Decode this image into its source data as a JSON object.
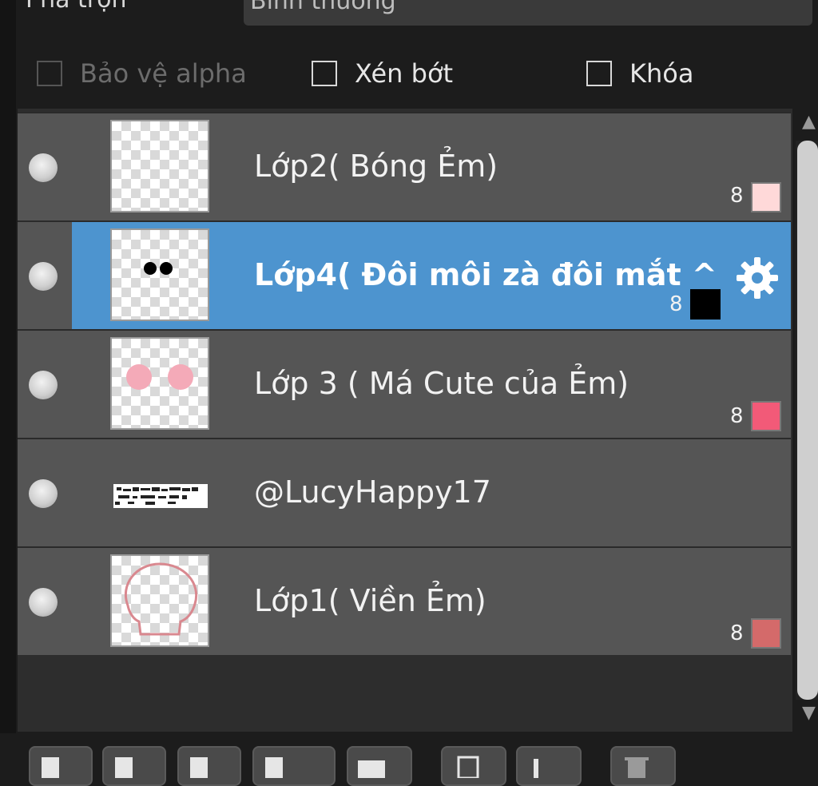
{
  "blend": {
    "label": "Pha trộn",
    "value": "Bình thường"
  },
  "options": [
    {
      "label": "Bảo vệ alpha",
      "checked": false,
      "enabled": false
    },
    {
      "label": "Xén bớt",
      "checked": false,
      "enabled": true
    },
    {
      "label": "Khóa",
      "checked": false,
      "enabled": true
    }
  ],
  "layers": [
    {
      "name": "Lớp2( Bóng Ẻm)",
      "badge": "8",
      "color": "#ffd9d9",
      "selected": false
    },
    {
      "name": "Lớp4( Đôi môi zà đôi mắt ^",
      "badge": "8",
      "color": "#000000",
      "selected": true
    },
    {
      "name": "Lớp 3 ( Má Cute của Ẻm)",
      "badge": "8",
      "color": "#f25a78",
      "selected": false
    },
    {
      "name": "@LucyHappy17",
      "badge": "",
      "color": "",
      "selected": false
    },
    {
      "name": "Lớp1( Viền Ẻm)",
      "badge": "8",
      "color": "#d46a6a",
      "selected": false
    }
  ],
  "colors": {
    "selection": "#4d94cf",
    "row": "#555555",
    "background": "#1c1c1c"
  }
}
